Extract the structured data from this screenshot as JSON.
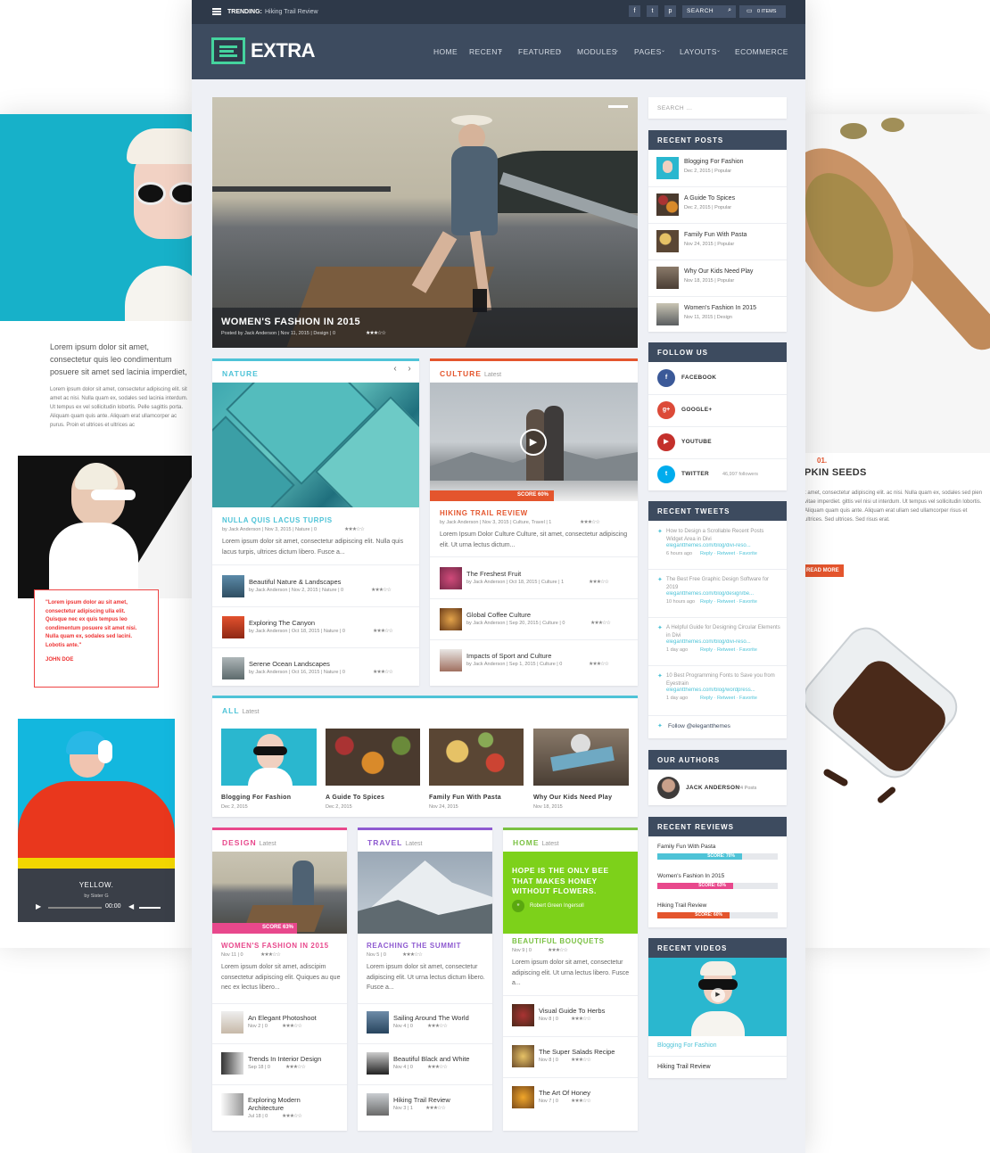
{
  "topbar": {
    "trending_label": "TRENDING:",
    "trending_text": "Hiking Trail Review",
    "search_placeholder": "SEARCH",
    "cart": "0 ITEMS"
  },
  "brand": {
    "logo": "EXTRA"
  },
  "nav": [
    "HOME",
    "RECENT",
    "FEATURED",
    "MODULES",
    "PAGES",
    "LAYOUTS",
    "ECOMMERCE"
  ],
  "hero": {
    "title": "WOMEN'S FASHION IN 2015",
    "meta": "Posted by Jack Anderson | Nov 11, 2015 | Design | 0"
  },
  "nature": {
    "title": "NATURE",
    "feature_title": "NULLA QUIS LACUS TURPIS",
    "feature_meta": "by Jack Anderson | Nov 3, 2015 | Nature | 0",
    "excerpt": "Lorem ipsum dolor sit amet, consectetur adipiscing elit. Nulla quis lacus turpis, ultrices dictum libero. Fusce a...",
    "items": [
      {
        "title": "Beautiful Nature & Landscapes",
        "meta": "by Jack Anderson | Nov 2, 2015 | Nature | 0"
      },
      {
        "title": "Exploring The Canyon",
        "meta": "by Jack Anderson | Oct 18, 2015 | Nature | 0"
      },
      {
        "title": "Serene Ocean Landscapes",
        "meta": "by Jack Anderson | Oct 16, 2015 | Nature | 0"
      }
    ]
  },
  "culture": {
    "title": "CULTURE",
    "sub": "Latest",
    "score": "SCORE 60%",
    "feature_title": "HIKING TRAIL REVIEW",
    "feature_meta": "by Jack Anderson | Nov 3, 2015 | Culture, Travel | 1",
    "excerpt": "Lorem Ipsum Dolor Culture Culture, sit amet, consectetur adipiscing elit. Ut urna lectus dictum...",
    "items": [
      {
        "title": "The Freshest Fruit",
        "meta": "by Jack Anderson | Oct 18, 2015 | Culture | 1"
      },
      {
        "title": "Global Coffee Culture",
        "meta": "by Jack Anderson | Sep 20, 2015 | Culture | 0"
      },
      {
        "title": "Impacts of Sport and Culture",
        "meta": "by Jack Anderson | Sep 1, 2015 | Culture | 0"
      }
    ]
  },
  "all": {
    "title": "ALL",
    "sub": "Latest",
    "items": [
      {
        "title": "Blogging For Fashion",
        "date": "Dec 2, 2015"
      },
      {
        "title": "A Guide To Spices",
        "date": "Dec 2, 2015"
      },
      {
        "title": "Family Fun With Pasta",
        "date": "Nov 24, 2015"
      },
      {
        "title": "Why Our Kids Need Play",
        "date": "Nov 18, 2015"
      }
    ]
  },
  "design": {
    "title": "DESIGN",
    "sub": "Latest",
    "score": "SCORE 63%",
    "feature_title": "WOMEN'S FASHION IN 2015",
    "feature_meta": "Nov 11 | 0",
    "excerpt": "Lorem ipsum dolor sit amet, adiscipim consectetur adipiscing elit. Quiques au que nec ex lectus libero...",
    "items": [
      {
        "title": "An Elegant Photoshoot",
        "meta": "Nov 2 | 0"
      },
      {
        "title": "Trends In Interior Design",
        "meta": "Sep 18 | 0"
      },
      {
        "title": "Exploring Modern Architecture",
        "meta": "Jul 18 | 0"
      }
    ]
  },
  "travel": {
    "title": "TRAVEL",
    "sub": "Latest",
    "feature_title": "REACHING THE SUMMIT",
    "feature_meta": "Nov 5 | 0",
    "excerpt": "Lorem ipsum dolor sit amet, consectetur adipiscing elit. Ut urna lectus dictum libero. Fusce a...",
    "items": [
      {
        "title": "Sailing Around The World",
        "meta": "Nov 4 | 0"
      },
      {
        "title": "Beautiful Black and White",
        "meta": "Nov 4 | 0"
      },
      {
        "title": "Hiking Trail Review",
        "meta": "Nov 3 | 1"
      }
    ]
  },
  "home": {
    "title": "HOME",
    "sub": "Latest",
    "quote": "HOPE IS THE ONLY BEE THAT MAKES HONEY WITHOUT FLOWERS.",
    "quote_author": "Robert Green Ingersoll",
    "feature_title": "BEAUTIFUL BOUQUETS",
    "feature_meta": "Nov 9 | 0",
    "excerpt": "Lorem ipsum dolor sit amet, consectetur adipiscing elit. Ut urna lectus libero. Fusce a...",
    "items": [
      {
        "title": "Visual Guide To Herbs",
        "meta": "Nov 8 | 0"
      },
      {
        "title": "The Super Salads Recipe",
        "meta": "Nov 8 | 0"
      },
      {
        "title": "The Art Of Honey",
        "meta": "Nov 7 | 0"
      }
    ]
  },
  "sidebar": {
    "search_placeholder": "SEARCH ...",
    "recent_posts": {
      "title": "RECENT POSTS",
      "items": [
        {
          "title": "Blogging For Fashion",
          "meta": "Dec 2, 2015 | Popular"
        },
        {
          "title": "A Guide To Spices",
          "meta": "Dec 2, 2015 | Popular"
        },
        {
          "title": "Family Fun With Pasta",
          "meta": "Nov 24, 2015 | Popular"
        },
        {
          "title": "Why Our Kids Need Play",
          "meta": "Nov 18, 2015 | Popular"
        },
        {
          "title": "Women's Fashion In 2015",
          "meta": "Nov 11, 2015 | Design"
        }
      ]
    },
    "follow": {
      "title": "FOLLOW US",
      "items": [
        {
          "name": "FACEBOOK",
          "extra": "",
          "color": "#3b5998",
          "icon": "f"
        },
        {
          "name": "GOOGLE+",
          "extra": "",
          "color": "#dc4a38",
          "icon": "g+"
        },
        {
          "name": "YOUTUBE",
          "extra": "",
          "color": "#c4302b",
          "icon": "▶"
        },
        {
          "name": "TWITTER",
          "extra": "46,997 followers",
          "color": "#00aced",
          "icon": "t"
        }
      ]
    },
    "tweets": {
      "title": "RECENT TWEETS",
      "items": [
        {
          "text": "How to Design a Scrollable Recent Posts Widget Area in Divi",
          "link": "elegantthemes.com/blog/divi-reso...",
          "time": "6 hours ago"
        },
        {
          "text": "The Best Free Graphic Design Software for 2019",
          "link": "elegantthemes.com/blog/design/be...",
          "time": "10 hours ago"
        },
        {
          "text": "A Helpful Guide for Designing Circular Elements in Divi",
          "link": "elegantthemes.com/blog/divi-reso...",
          "time": "1 day ago"
        },
        {
          "text": "10 Best Programming Fonts to Save you from Eyestrain",
          "link": "elegantthemes.com/blog/wordpress...",
          "time": "1 day ago"
        }
      ],
      "actions": "Reply · Retweet · Favorite",
      "follow": "Follow @elegantthemes"
    },
    "authors": {
      "title": "OUR AUTHORS",
      "name": "JACK ANDERSON",
      "posts": "24 Posts"
    },
    "reviews": {
      "title": "RECENT REVIEWS",
      "items": [
        {
          "title": "Family Fun With Pasta",
          "label": "SCORE: 70%",
          "score": 0.7,
          "color": "#4ec3d7"
        },
        {
          "title": "Women's Fashion In 2015",
          "label": "SCORE: 63%",
          "score": 0.63,
          "color": "#e8488c"
        },
        {
          "title": "Hiking Trail Review",
          "label": "SCORE: 60%",
          "score": 0.6,
          "color": "#e4552d"
        }
      ]
    },
    "videos": {
      "title": "RECENT VIDEOS",
      "items": [
        "Blogging For Fashion",
        "Hiking Trail Review"
      ]
    }
  },
  "left_panel": {
    "intro": "Lorem ipsum dolor sit amet, consectetur quis leo condimentum posuere sit amet sed lacinia imperdiet, sodales at sem. L",
    "body": "Lorem ipsum dolor sit amet, consectetur adipiscing elit. sit amet ac nisi. Nulla quam ex, sodales sed lacinia interdum. Ut tempus ex vel sollicitudin lobortis. Pelle sagittis porta. Aliquam quam quis ante. Aliquam erat ullamcorper ac purus. Proin et ultrices et ultrices ac",
    "quote": "\"Lorem ipsum dolor au sit amet, consectetur adipiscing ulla elit. Quisque nec ex quis tempus leo condimentum posuere sit amet nisi. Nulla quam ex, sodales sed lacini. Lobotis ante.\"",
    "quote_author": "JOHN DOE",
    "audio_title": "YELLOW.",
    "audio_artist": "by Sister G",
    "audio_time": "00:00"
  },
  "right_panel": {
    "num": "01.",
    "title": "PKIN SEEDS",
    "body": "t amet, consectetur adipiscing elit. ac nisi. Nulla quam ex, sodales sed pien vitae imperdiet. gittis vel nisi ut interdum. Ut tempus vel sollicitudin lobortis. Aliquam quam quis ante. Aliquam erat ullam sed ullamcorper risus et ultrices. Sed ultrices. Sed risus erat.",
    "button": "READ MORE"
  }
}
